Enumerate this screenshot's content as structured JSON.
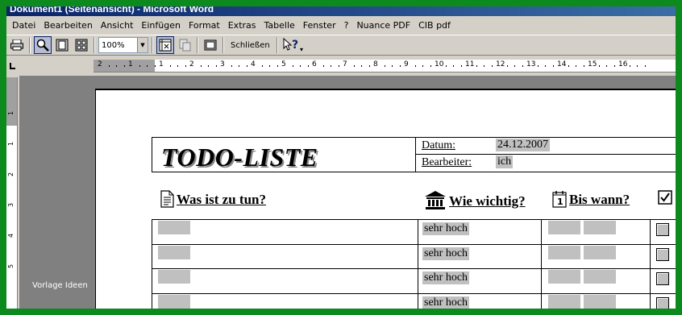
{
  "window": {
    "title": "Dokument1 (Seitenansicht) - Microsoft Word"
  },
  "menu": [
    "Datei",
    "Bearbeiten",
    "Ansicht",
    "Einfügen",
    "Format",
    "Extras",
    "Tabelle",
    "Fenster",
    "?",
    "Nuance PDF",
    "CIB pdf"
  ],
  "toolbar": {
    "zoom_value": "100%",
    "close_label": "Schließen",
    "icons": [
      "print-icon",
      "magnifier-icon",
      "one-page-icon",
      "multiple-pages-icon",
      "view-ruler-icon",
      "shrink-to-fit-icon",
      "full-screen-icon",
      "context-help-icon"
    ]
  },
  "ruler": {
    "horizontal": [
      "2",
      "1",
      "1",
      "2",
      "3",
      "4",
      "5",
      "6",
      "7",
      "8",
      "9",
      "10",
      "11",
      "12",
      "13",
      "14",
      "15",
      "16"
    ],
    "vertical": [
      "1",
      "1",
      "2",
      "3",
      "4",
      "5"
    ]
  },
  "status": {
    "style_label": "Vorlage Ideen"
  },
  "document": {
    "title": "TODO-LISTE",
    "date_label": "Datum:",
    "date_value": "24.12.2007",
    "editor_label": "Bearbeiter:",
    "editor_value": "ich",
    "columns": {
      "task": "Was ist zu tun?",
      "priority": "Wie wichtig?",
      "deadline": "Bis wann?"
    },
    "rows": [
      {
        "priority": "sehr hoch"
      },
      {
        "priority": "sehr hoch"
      },
      {
        "priority": "sehr hoch"
      },
      {
        "priority": "sehr hoch"
      }
    ]
  }
}
